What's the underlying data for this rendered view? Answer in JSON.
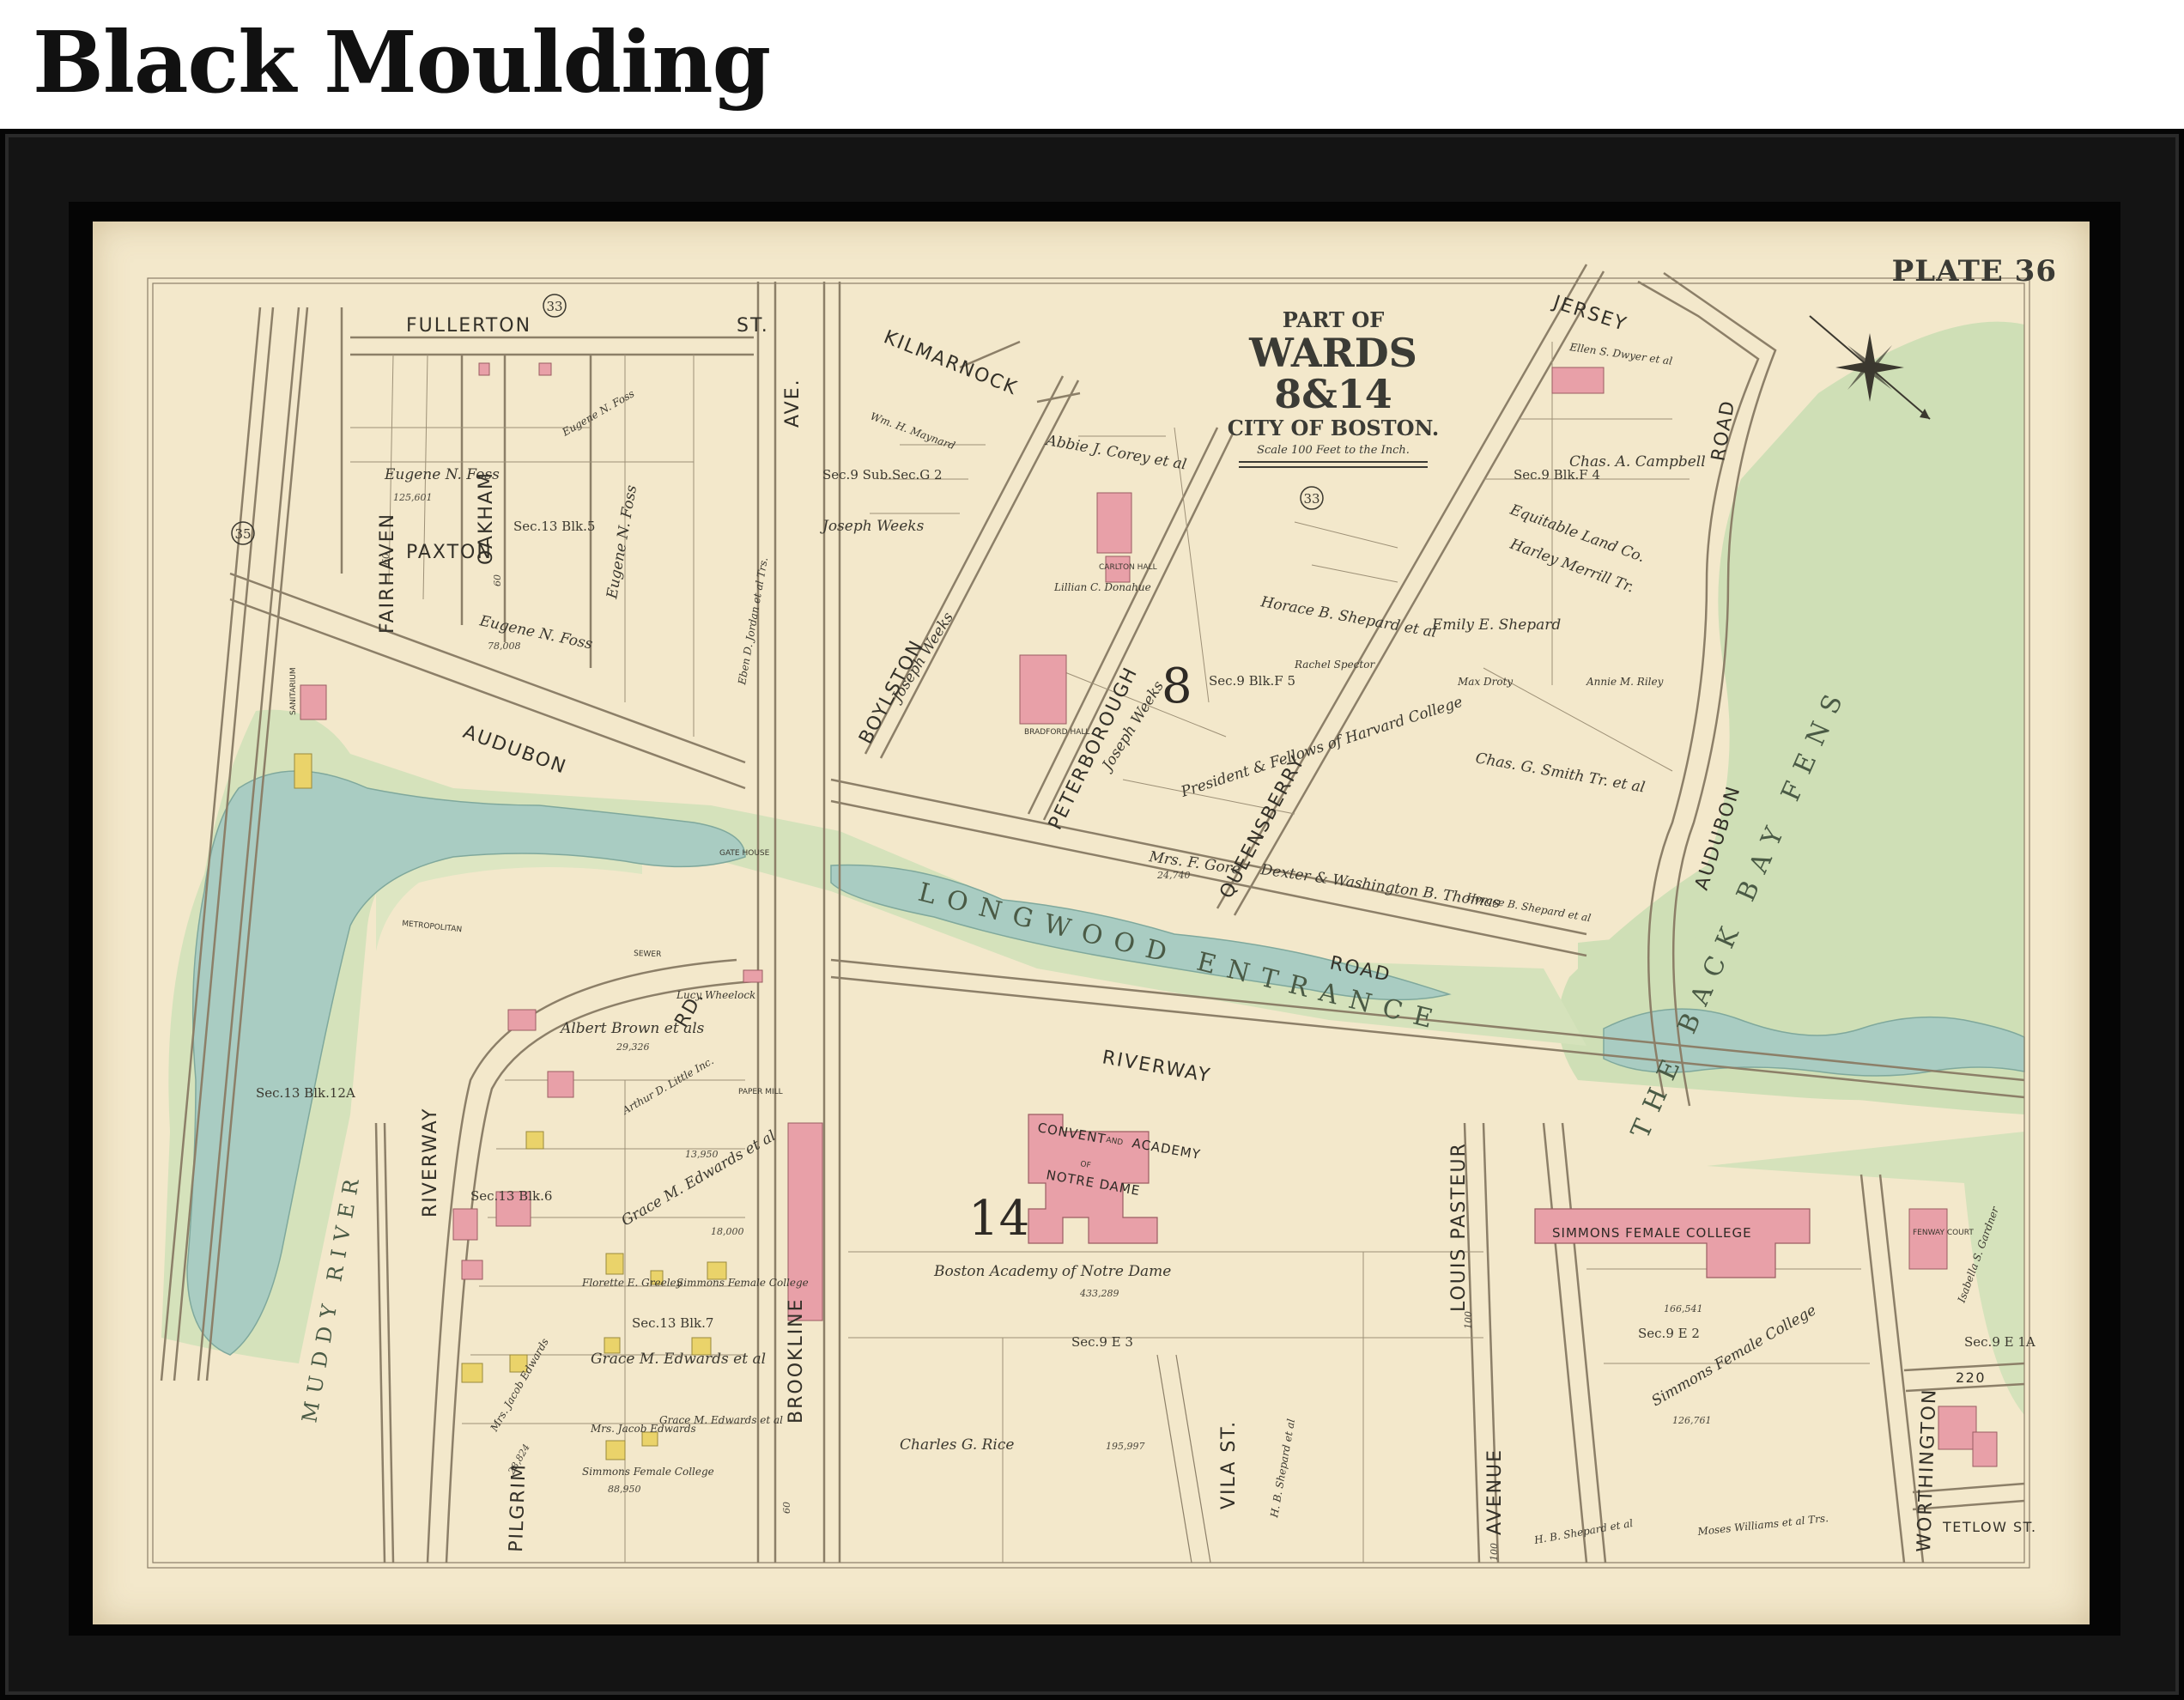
{
  "page": {
    "heading": "Black Moulding"
  },
  "map": {
    "plate": "PLATE 36",
    "title": {
      "line1": "PART OF",
      "line2": "WARDS 8&14",
      "line3": "CITY OF BOSTON.",
      "scale_note": "Scale 100 Feet to the Inch."
    },
    "ward_numbers": [
      "8",
      "14"
    ],
    "circle_numbers": [
      "33",
      "33",
      "35"
    ],
    "streets": {
      "fullerton": "FULLERTON",
      "st": "ST.",
      "kilmarnock": "KILMARNOCK",
      "jersey": "JERSEY",
      "fairhaven": "FAIRHAVEN",
      "oakham": "OAKHAM",
      "paxton": "PAXTON",
      "audubon": "AUDUBON",
      "ave": "AVE.",
      "boylston": "BOYLSTON",
      "peterborough": "PETERBOROUGH",
      "queensberry": "QUEENSBERRY",
      "road": "ROAD",
      "riverway": "RIVERWAY",
      "rd": "RD.",
      "pilgrim": "PILGRIM",
      "brookline": "BROOKLINE",
      "vila_st": "VILA ST.",
      "louis_pasteur": "LOUIS PASTEUR",
      "avenue": "AVENUE",
      "worthington": "WORTHINGTON",
      "tetlow_st": "TETLOW ST.",
      "st_220": "220",
      "longwood_entrance": "LONGWOOD ENTRANCE",
      "muddy_river": "MUDDY RIVER",
      "back_bay_fens": "THE BACK BAY FENS",
      "metropolitan": "METROPOLITAN",
      "sewer": "SEWER"
    },
    "buildings": {
      "convent": [
        "CONVENT",
        "AND",
        "ACADEMY",
        "OF",
        "NOTRE DAME"
      ],
      "simmons": "SIMMONS FEMALE COLLEGE",
      "fenway_court": "FENWAY COURT",
      "sanitarium": "SANITARIUM",
      "carlton_hall": "CARLTON HALL",
      "bradford_hall": "BRADFORD HALL",
      "gate_house": "GATE HOUSE",
      "paper_mill": "PAPER MILL"
    },
    "sections": [
      "Sec.13 Blk.5",
      "Sec.9 Blk.F 4",
      "Sec.9 Blk.F 5",
      "Sec.13 Blk.12A",
      "Sec.13 Blk.6",
      "Sec.13 Blk.7",
      "Sec.9 E 3",
      "Sec.9 E 2",
      "Sec.9 E 1A",
      "Sec.9 Sub.Sec.G 2"
    ],
    "owners": {
      "eugene_foss_1": "Eugene N. Foss",
      "eugene_foss_2": "Eugene N. Foss",
      "eugene_foss_3": "Eugene N. Foss",
      "eugene_foss_4": "Eugene N. Foss",
      "abbie_corey": "Abbie J. Corey et al",
      "joseph_weeks_1": "Joseph Weeks",
      "joseph_weeks_2": "Joseph Weeks",
      "joseph_weeks_3": "Joseph Weeks",
      "wm_maynard": "Wm. H. Maynard",
      "lillian_donahue": "Lillian C. Donahue",
      "horace_shepard": "Horace B. Shepard et al",
      "emily_shepard": "Emily E. Shepard",
      "chas_campbell": "Chas. A. Campbell",
      "equitable": "Equitable Land Co.",
      "harley": "Harley Merrill Tr.",
      "annie_riley": "Annie M. Riley",
      "rachel_specter": "Rachel Spector",
      "max_droty": "Max Droty",
      "president_harvard": "President & Fellows of Harvard College",
      "chas_smith": "Chas. G. Smith Tr. et al",
      "dexter_washington": "Dexter & Washington B. Thomas",
      "horace_shepard_2": "Horace B. Shepard et al",
      "mrs_f_gore": "Mrs. F. Gore",
      "albert_brown": "Albert Brown et als",
      "arthur_little": "Arthur D. Little Inc.",
      "grace_edwards_1": "Grace M. Edwards et al",
      "grace_edwards_2": "Grace M. Edwards et al",
      "grace_edwards_3": "Grace M. Edwards et al",
      "florette_greeley": "Florette E. Greeley",
      "simmons_1": "Simmons Female College",
      "simmons_2": "Simmons Female College",
      "simmons_3": "Simmons Female College",
      "mrs_jacob_edwards_1": "Mrs. Jacob Edwards",
      "mrs_jacob_edwards_2": "Mrs. Jacob Edwards",
      "boston_academy": "Boston Academy of Notre Dame",
      "charles_rice": "Charles G. Rice",
      "hb_shepard_1": "H. B. Shepard et al",
      "hb_shepard_2": "H. B. Shepard et al",
      "moses_williams": "Moses Williams et al Trs.",
      "isabella_gardner": "Isabella S. Gardner",
      "lucy_wheelock": "Lucy Wheelock",
      "eben_jordan": "Eben D. Jordan et al Trs.",
      "ellen_dwyer": "Ellen S. Dwyer et al"
    },
    "areas": {
      "foss_1": "125,601",
      "foss_2": "78,008",
      "convent": "433,289",
      "simmons_main": "166,541",
      "simmons_2": "126,761",
      "rice": "195,997",
      "gore": "24,740",
      "albert_brown": "29,326",
      "grace_1": "13,950",
      "grace_2": "18,000",
      "jacob_edwards_area": "28,824",
      "simmons_3": "88,950"
    },
    "lot_numbers": [
      "60",
      "60",
      "100",
      "100",
      "60"
    ]
  }
}
